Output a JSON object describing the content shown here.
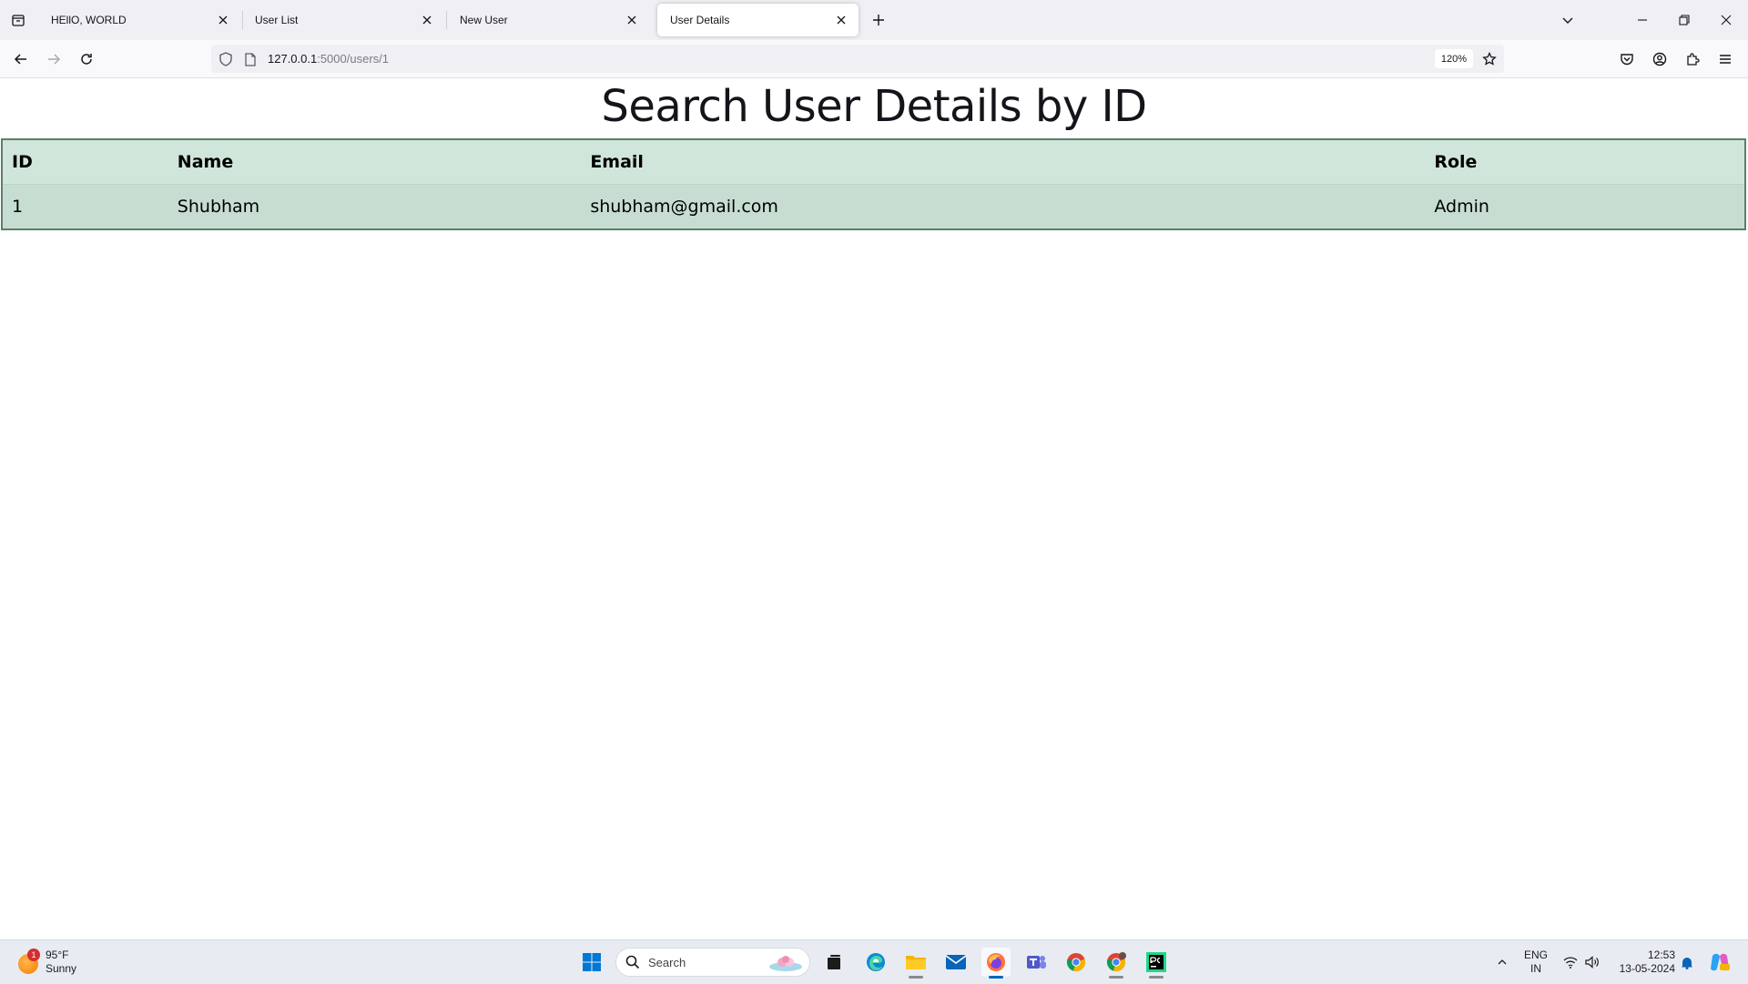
{
  "browser": {
    "tabs": [
      {
        "title": "HEllO, WORLD",
        "active": false
      },
      {
        "title": "User List",
        "active": false
      },
      {
        "title": "New User",
        "active": false
      },
      {
        "title": "User Details",
        "active": true
      }
    ],
    "url_host": "127.0.0.1",
    "url_path": ":5000/users/1",
    "zoom": "120%"
  },
  "page": {
    "title": "Search User Details by ID",
    "table": {
      "headers": [
        "ID",
        "Name",
        "Email",
        "Role"
      ],
      "rows": [
        [
          "1",
          "Shubham",
          "shubham@gmail.com",
          "Admin"
        ]
      ]
    }
  },
  "taskbar": {
    "weather_temp": "95°F",
    "weather_condition": "Sunny",
    "weather_badge": "1",
    "search_placeholder": "Search",
    "language_line1": "ENG",
    "language_line2": "IN",
    "time": "12:53",
    "date": "13-05-2024"
  },
  "colors": {
    "table_header_bg": "#d0e6db",
    "table_row_bg": "#c7ddd2",
    "table_border": "#5b7f6c",
    "active_indicator": "#0067c0"
  }
}
